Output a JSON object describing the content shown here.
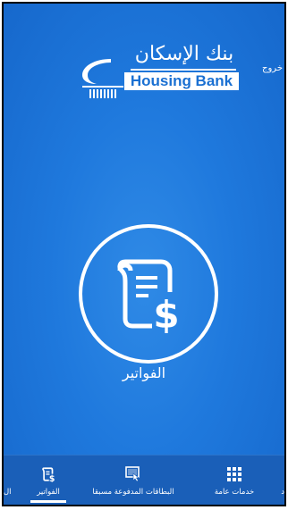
{
  "header": {
    "logout_label": "خروج",
    "logo_arabic": "بنك الإسكان",
    "logo_english": "Housing Bank"
  },
  "main": {
    "feature_label": "الفواتير",
    "feature_icon": "bill-dollar-icon"
  },
  "tabbar": {
    "items": [
      {
        "label": "ال",
        "icon": "",
        "active": false
      },
      {
        "label": "الفواتير",
        "icon": "bill-dollar-icon",
        "active": true
      },
      {
        "label": "البطاقات المدفوعة مسبقا",
        "icon": "prepaid-card-icon",
        "active": false
      },
      {
        "label": "خدمات عامة",
        "icon": "grid-dots-icon",
        "active": false
      },
      {
        "label": "د",
        "icon": "",
        "active": false
      }
    ]
  },
  "colors": {
    "background": "#1f79dd",
    "tabbar": "#1a5fb8",
    "foreground": "#ffffff"
  }
}
